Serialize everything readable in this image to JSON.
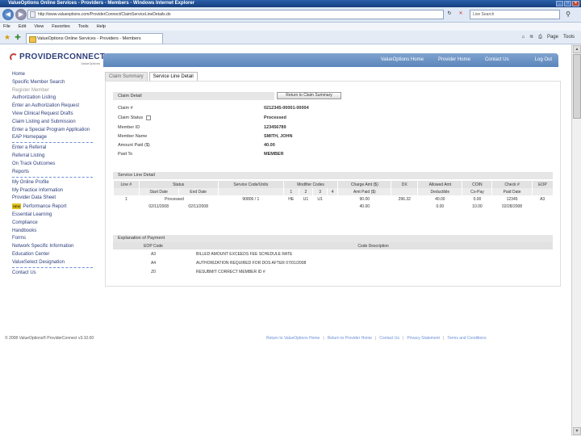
{
  "window": {
    "title": "ValueOptions Online Services - Providers - Members - Windows Internet Explorer"
  },
  "browser": {
    "url": "http://www.valueoptions.com/ProviderConnect/ClaimServiceLineDetails.do",
    "search_placeholder": "Live Search",
    "menu": [
      "File",
      "Edit",
      "View",
      "Favorites",
      "Tools",
      "Help"
    ],
    "tab_label": "ValueOptions Online Services - Providers - Members",
    "tools": [
      "Page",
      "Tools"
    ]
  },
  "app": {
    "logo": "PROVIDERCONNECT",
    "logo_sub": "ValueOptions",
    "topnav": [
      "ValueOptions Home",
      "Provider Home",
      "Contact Us",
      "Log Out"
    ]
  },
  "leftnav": [
    {
      "label": "Home"
    },
    {
      "label": "Specific Member Search"
    },
    {
      "label": "Register Member",
      "gray": true
    },
    {
      "label": "Authorization Listing"
    },
    {
      "label": "Enter an Authorization Request"
    },
    {
      "label": "View Clinical Request Drafts"
    },
    {
      "label": "Claim Listing and Submission"
    },
    {
      "label": "Enter a Special Program Application"
    },
    {
      "label": "EAP Homepage",
      "dash": true
    },
    {
      "label": "Enter a Referral"
    },
    {
      "label": "Referral Listing"
    },
    {
      "label": "On Track Outcomes"
    },
    {
      "label": "Reports",
      "dash": true
    },
    {
      "label": "My Online Profile"
    },
    {
      "label": "My Practice Information"
    },
    {
      "label": "Provider Data Sheet"
    },
    {
      "label": "Performance Report",
      "new": "NEW"
    },
    {
      "label": "Essential Learning"
    },
    {
      "label": "Compliance"
    },
    {
      "label": "Handbooks"
    },
    {
      "label": "Forms"
    },
    {
      "label": "Network Specific Information"
    },
    {
      "label": "Education Center"
    },
    {
      "label": "ValueSelect Designation",
      "dash": true
    },
    {
      "label": "Contact Us"
    }
  ],
  "content_tabs": [
    "Claim Summary",
    "Service Line Detail"
  ],
  "claim_detail": {
    "header": "Claim Detail",
    "return_button": "Return to Claim Summary",
    "fields": [
      {
        "label": "Claim #",
        "value": "0212345-00001-00004"
      },
      {
        "label": "Claim Status",
        "value": "Processed"
      },
      {
        "label": "Member ID",
        "value": "123456789"
      },
      {
        "label": "Member Name",
        "value": "SMITH, JOHN"
      },
      {
        "label": "Amount Paid ($)",
        "value": "40.00"
      },
      {
        "label": "Paid To",
        "value": "MEMBER"
      }
    ]
  },
  "service_line": {
    "header": "Service Line Detail",
    "columns_row1": [
      "Line #",
      "Status",
      "Service Code/Units",
      "Modifier Codes",
      "Charge Amt ($)",
      "DX",
      "Allowed Amt",
      "COIN",
      "Check #",
      "EOP"
    ],
    "columns_row2": [
      "Start Date",
      "End Date",
      "1",
      "2",
      "3",
      "4",
      "Amt Paid ($)",
      "Deductible",
      "Co-Pay",
      "Paid Date"
    ],
    "rows": [
      {
        "line": "1",
        "status": "Processed",
        "start": "02/11/2008",
        "end": "02/11/2008",
        "code": "90806 / 1",
        "m1": "HE",
        "m2": "U1",
        "m3": "U1",
        "m4": "",
        "charge": "90.00",
        "paid": "40.00",
        "dx": "296.32",
        "allowed": "40.00",
        "deductible": "0.00",
        "coin": "0.00",
        "copay": "10.00",
        "check": "12345",
        "paid_date": "02/28/2008",
        "eop": "A3"
      }
    ]
  },
  "explanation": {
    "header": "Explanation of Payment",
    "columns": [
      "EOP Code",
      "Code Description"
    ],
    "rows": [
      {
        "code": "A3",
        "desc": "BILLED AMOUNT EXCEEDS FEE SCHEDULE RATE"
      },
      {
        "code": "A4",
        "desc": "AUTHORIZATION REQUIRED FOR DOS AFTER 07/01/2008"
      },
      {
        "code": "Z0",
        "desc": "RESUBMIT CORRECT MEMBER ID #"
      }
    ]
  },
  "footer": {
    "copyright": "© 2008 ValueOptions® ProviderConnect v3.10.00",
    "links": [
      "Return to ValueOptions Home",
      "Return to Provider Home",
      "Contact Us",
      "Privacy Statement",
      "Terms and Conditions"
    ]
  }
}
